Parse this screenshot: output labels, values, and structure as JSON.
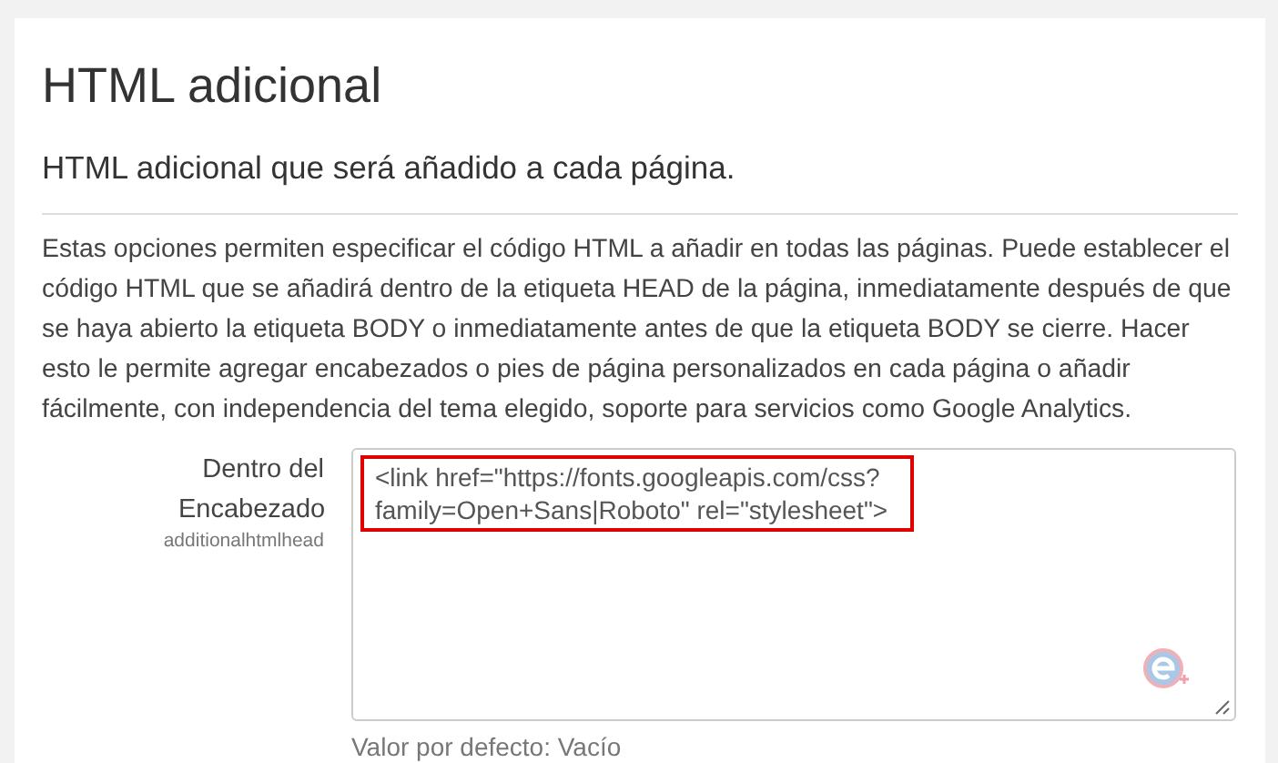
{
  "page": {
    "title": "HTML adicional",
    "subtitle": "HTML adicional que será añadido a cada página.",
    "description": "Estas opciones permiten especificar el código HTML a añadir en todas las páginas. Puede establecer el código HTML que se añadirá dentro de la etiqueta HEAD de la página, inmediatamente después de que se haya abierto la etiqueta BODY o inmediatamente antes de que la etiqueta BODY se cierre. Hacer esto le permite agregar encabezados o pies de página personalizados en cada página o añadir fácilmente, con independencia del tema elegido, soporte para servicios como Google Analytics."
  },
  "setting": {
    "label": "Dentro del Encabezado",
    "name": "additionalhtmlhead",
    "value": "<link href=\"https://fonts.googleapis.com/css?family=Open+Sans|Roboto\" rel=\"stylesheet\">",
    "highlighted": true,
    "default": "Valor por defecto: Vacío"
  }
}
